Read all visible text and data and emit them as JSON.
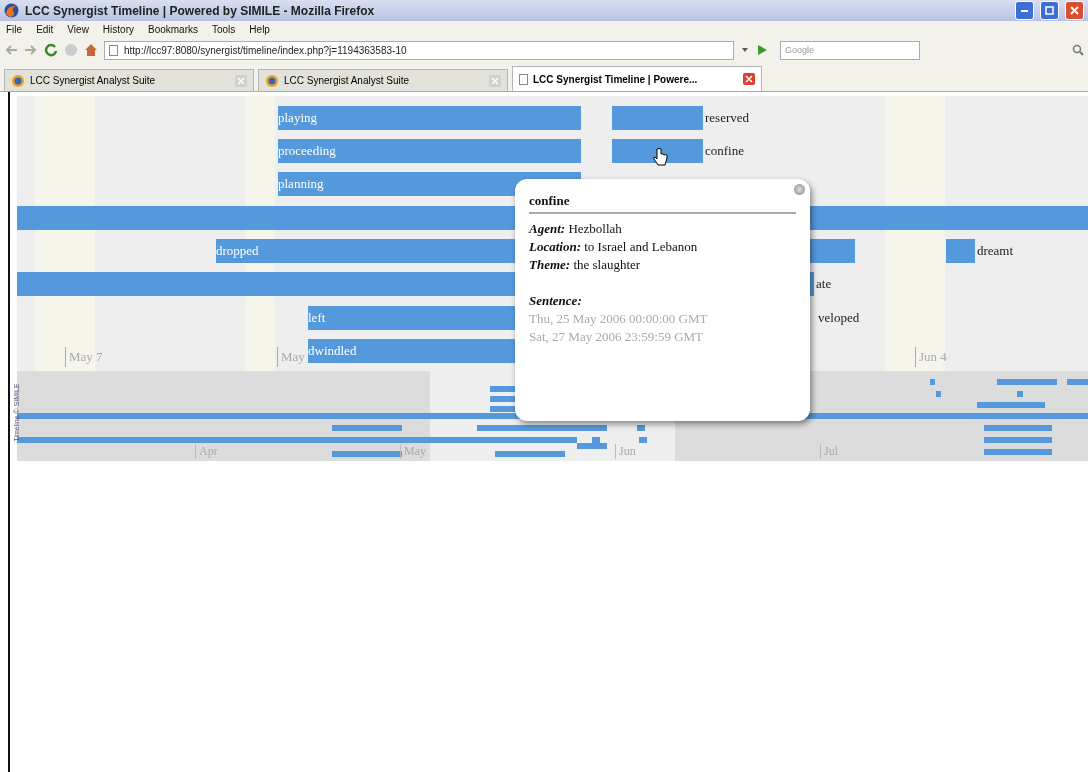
{
  "window": {
    "title": "LCC Synergist Timeline | Powered by SIMILE - Mozilla Firefox"
  },
  "menu": [
    "File",
    "Edit",
    "View",
    "History",
    "Bookmarks",
    "Tools",
    "Help"
  ],
  "address_bar": {
    "value": "http://lcc97:8080/synergist/timeline/index.php?j=1194363583-10"
  },
  "search": {
    "placeholder": "Google"
  },
  "tabs": [
    {
      "label": "LCC Synergist Analyst Suite",
      "selected": false
    },
    {
      "label": "LCC Synergist Analyst Suite",
      "selected": false
    },
    {
      "label": "LCC Synergist Timeline | Powere...",
      "selected": true
    }
  ],
  "timeline": {
    "events": [
      {
        "kind": "inside",
        "label": "playing"
      },
      {
        "kind": "after",
        "label": "reserved"
      },
      {
        "kind": "inside",
        "label": "proceeding"
      },
      {
        "kind": "after",
        "label": "confine"
      },
      {
        "kind": "inside",
        "label": "planning"
      },
      {
        "kind": "plain"
      },
      {
        "kind": "inside",
        "label": "dropped"
      },
      {
        "kind": "after",
        "label": "dreamt"
      },
      {
        "kind": "after",
        "label": "ate"
      },
      {
        "kind": "inside",
        "label": "left"
      },
      {
        "kind": "text",
        "label": "veloped"
      },
      {
        "kind": "inside",
        "label": "dwindled"
      }
    ],
    "date_markers": [
      "May 7",
      "May",
      "Jun 4"
    ],
    "overview_months": [
      "Apr",
      "May",
      "Jun",
      "Jul"
    ],
    "credit": "Timeline © SIMILE"
  },
  "popup": {
    "title": "confine",
    "fields": [
      {
        "name": "Agent:",
        "value": "Hezbollah"
      },
      {
        "name": "Location:",
        "value": "to Israel and Lebanon"
      },
      {
        "name": "Theme:",
        "value": "the slaughter"
      }
    ],
    "sentence_label": "Sentence:",
    "dates": [
      "Thu, 25 May 2006 00:00:00 GMT",
      "Sat, 27 May 2006 23:59:59 GMT"
    ]
  }
}
